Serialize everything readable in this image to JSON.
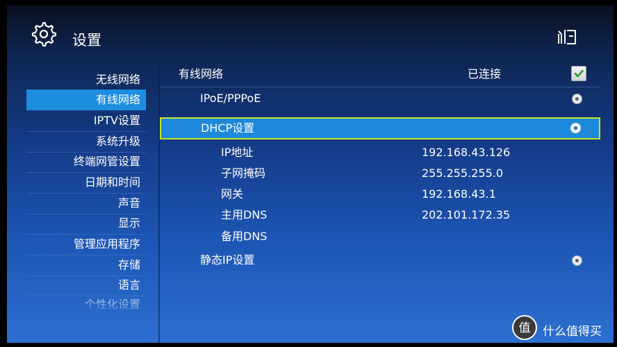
{
  "header": {
    "title": "设置",
    "settings_icon": "gear-icon",
    "display_icon": "tv-icon"
  },
  "sidebar": {
    "items": [
      {
        "label": "无线网络"
      },
      {
        "label": "有线网络",
        "active": true
      },
      {
        "label": "IPTV设置"
      },
      {
        "label": "系统升级"
      },
      {
        "label": "终端网管设置"
      },
      {
        "label": "日期和时间"
      },
      {
        "label": "声音"
      },
      {
        "label": "显示"
      },
      {
        "label": "管理应用程序"
      },
      {
        "label": "存储"
      },
      {
        "label": "语言"
      },
      {
        "label": "个性化设置"
      }
    ]
  },
  "content": {
    "wired_label": "有线网络",
    "wired_status": "已连接",
    "wired_enabled": true,
    "options": {
      "ipoe": "IPoE/PPPoE",
      "dhcp": "DHCP设置",
      "static": "静态IP设置"
    },
    "selected_option": "dhcp",
    "details": [
      {
        "label": "IP地址",
        "value": "192.168.43.126"
      },
      {
        "label": "子网掩码",
        "value": "255.255.255.0"
      },
      {
        "label": "网关",
        "value": "192.168.43.1"
      },
      {
        "label": "主用DNS",
        "value": "202.101.172.35"
      },
      {
        "label": "备用DNS",
        "value": ""
      }
    ]
  },
  "watermark": {
    "logo_text": "值",
    "text": "什么值得买"
  },
  "colors": {
    "selection_fill": "#1e89da",
    "selection_border": "#c9e51e",
    "sidebar_active": "#1d8de0"
  }
}
